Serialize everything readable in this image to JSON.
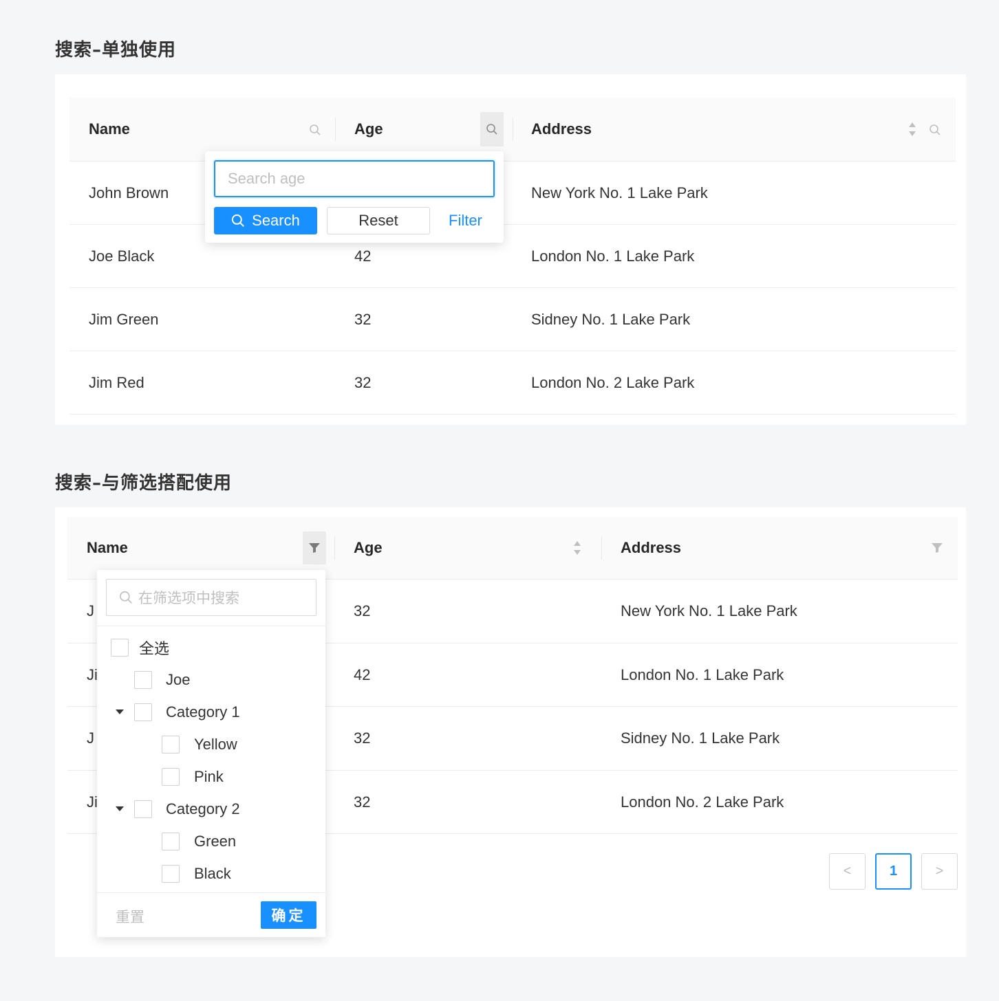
{
  "section1": {
    "title": "搜索–单独使用",
    "columns": [
      "Name",
      "Age",
      "Address"
    ],
    "rows": [
      {
        "name": "John Brown",
        "age": "",
        "address": "New York No. 1 Lake Park"
      },
      {
        "name": "Joe Black",
        "age": "42",
        "address": "London No. 1 Lake Park"
      },
      {
        "name": "Jim Green",
        "age": "32",
        "address": "Sidney No. 1 Lake Park"
      },
      {
        "name": "Jim Red",
        "age": "32",
        "address": "London No. 2 Lake Park"
      }
    ],
    "popover": {
      "placeholder": "Search age",
      "search_label": "Search",
      "reset_label": "Reset",
      "filter_label": "Filter"
    }
  },
  "section2": {
    "title": "搜索–与筛选搭配使用",
    "columns": [
      "Name",
      "Age",
      "Address"
    ],
    "rows": [
      {
        "name": "J",
        "age": "32",
        "address": "New York No. 1 Lake Park"
      },
      {
        "name": "Ji",
        "age": "42",
        "address": "London No. 1 Lake Park"
      },
      {
        "name": "J",
        "age": "32",
        "address": "Sidney No. 1 Lake Park"
      },
      {
        "name": "Ji",
        "age": "32",
        "address": "London No. 2 Lake Park"
      }
    ],
    "filter": {
      "search_placeholder": "在筛选项中搜索",
      "select_all": "全选",
      "items": {
        "joe": "Joe",
        "category1": "Category 1",
        "yellow": "Yellow",
        "pink": "Pink",
        "category2": "Category 2",
        "green": "Green",
        "black": "Black"
      },
      "reset_label": "重置",
      "ok_label": "确定"
    },
    "pagination": {
      "prev": "<",
      "current": "1",
      "next": ">"
    }
  },
  "colors": {
    "primary": "#1890ff",
    "background": "#f5f6f8",
    "header": "#fafafa"
  },
  "icons": [
    "search-icon",
    "sort-icon",
    "filter-icon",
    "caret-down-icon"
  ]
}
